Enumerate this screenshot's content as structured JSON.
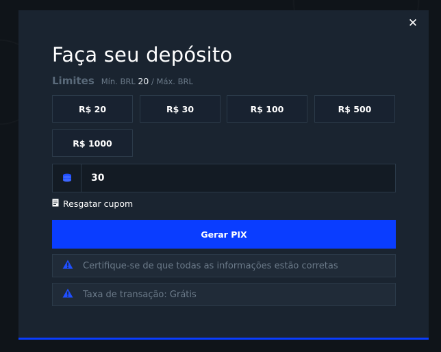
{
  "modal": {
    "title": "Faça seu depósito",
    "close_icon": "close-icon",
    "limits": {
      "label": "Limites",
      "min_prefix": "Mín. BRL",
      "min_value": "20",
      "separator": "/",
      "max_text": "Máx. BRL"
    },
    "amount_options": [
      "R$ 20",
      "R$ 30",
      "R$ 100",
      "R$ 500",
      "R$ 1000"
    ],
    "amount_input": {
      "icon": "coins-icon",
      "value": "30"
    },
    "coupon": {
      "icon": "receipt-icon",
      "label": "Resgatar cupom"
    },
    "generate_button": "Gerar PIX",
    "notices": [
      {
        "icon": "warning-icon",
        "text": "Certifique-se de que todas as informações estão corretas"
      },
      {
        "icon": "warning-icon",
        "text": "Taxa de transação: Grátis"
      }
    ],
    "colors": {
      "accent": "#0a3dff",
      "modal_bg": "#1a2430",
      "page_bg": "#0f1419"
    }
  }
}
